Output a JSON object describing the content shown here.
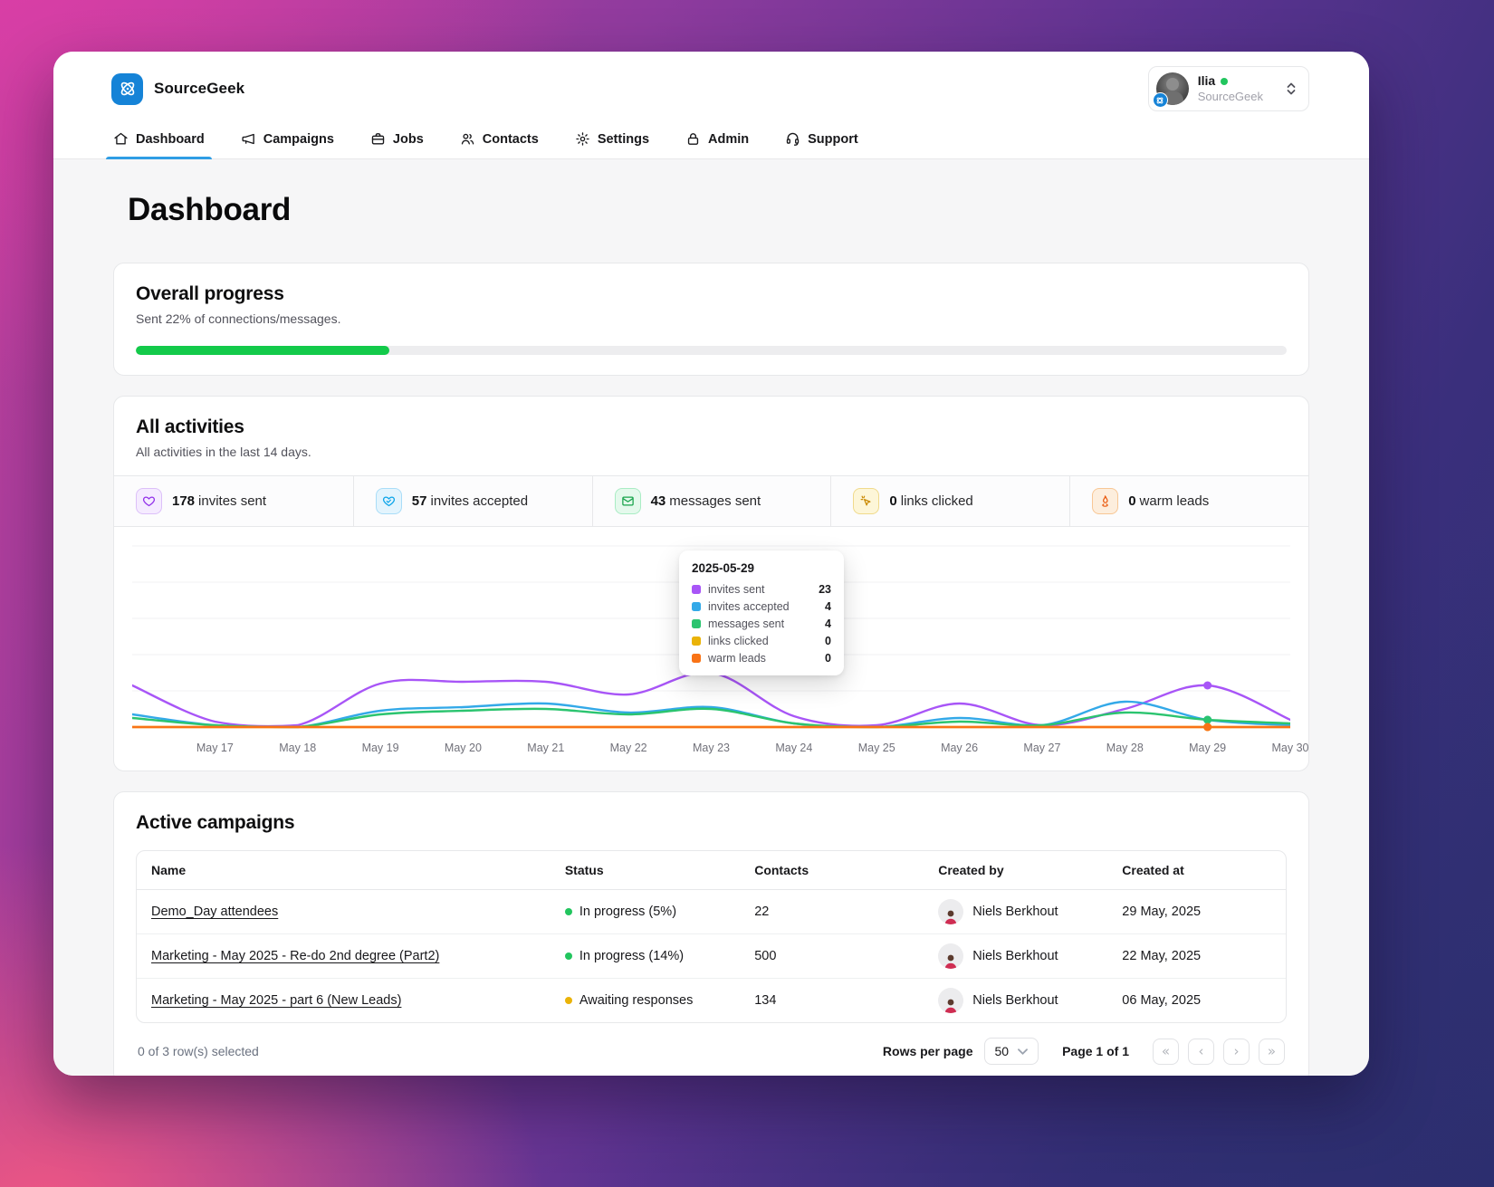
{
  "brand": {
    "name": "SourceGeek"
  },
  "user_menu": {
    "name": "Ilia",
    "org": "SourceGeek",
    "status_color": "#22c55e"
  },
  "nav": {
    "items": [
      {
        "label": "Dashboard",
        "active": true
      },
      {
        "label": "Campaigns",
        "active": false
      },
      {
        "label": "Jobs",
        "active": false
      },
      {
        "label": "Contacts",
        "active": false
      },
      {
        "label": "Settings",
        "active": false
      },
      {
        "label": "Admin",
        "active": false
      },
      {
        "label": "Support",
        "active": false
      }
    ]
  },
  "page": {
    "title": "Dashboard"
  },
  "overall_progress": {
    "title": "Overall progress",
    "subtitle": "Sent 22% of connections/messages.",
    "percent": 22,
    "bar_color": "#13ca4a",
    "track_color": "#ededef"
  },
  "activities": {
    "title": "All activities",
    "subtitle": "All activities in the last 14 days.",
    "stats": [
      {
        "value": "178",
        "label": "invites sent",
        "bg": "#f5ebff",
        "border": "#dcc0f9",
        "fg": "#9333ea"
      },
      {
        "value": "57",
        "label": "invites accepted",
        "bg": "#e3f4fd",
        "border": "#a9ddf8",
        "fg": "#0ea5e9"
      },
      {
        "value": "43",
        "label": "messages sent",
        "bg": "#e4f9ec",
        "border": "#a9ecc4",
        "fg": "#16a34a"
      },
      {
        "value": "0",
        "label": "links clicked",
        "bg": "#fdf6d8",
        "border": "#f0da8c",
        "fg": "#ca8a04"
      },
      {
        "value": "0",
        "label": "warm leads",
        "bg": "#fdeedd",
        "border": "#f8c795",
        "fg": "#ea580c"
      }
    ]
  },
  "chart_data": {
    "type": "line",
    "x_labels": [
      "May 17",
      "May 18",
      "May 19",
      "May 20",
      "May 21",
      "May 22",
      "May 23",
      "May 24",
      "May 25",
      "May 26",
      "May 27",
      "May 28",
      "May 29",
      "May 30"
    ],
    "ylim": [
      0,
      100
    ],
    "grid": "horizontal gridlines every 20, no y tick labels, legend shown only in hover tooltip",
    "hover_index": 13,
    "note": "values[0] is the unlabeled left-edge point one step before May 17; non-tooltip values estimated from pixels",
    "series": [
      {
        "name": "invites sent",
        "color": "#a855f7",
        "values": [
          23,
          3,
          1,
          24,
          25,
          25,
          18,
          30,
          6,
          1,
          13,
          1,
          10,
          23,
          4
        ]
      },
      {
        "name": "invites accepted",
        "color": "#33a9e8",
        "values": [
          7,
          1,
          0,
          9,
          11,
          13,
          8,
          11,
          2,
          0,
          5,
          1,
          14,
          4,
          1
        ]
      },
      {
        "name": "messages sent",
        "color": "#2bc46f",
        "values": [
          5,
          1,
          0,
          7,
          9,
          10,
          7,
          10,
          2,
          0,
          3,
          1,
          8,
          4,
          2
        ]
      },
      {
        "name": "links clicked",
        "color": "#eab308",
        "values": [
          0,
          0,
          0,
          0,
          0,
          0,
          0,
          0,
          0,
          0,
          0,
          0,
          0,
          0,
          0
        ]
      },
      {
        "name": "warm leads",
        "color": "#f97316",
        "values": [
          0,
          0,
          0,
          0,
          0,
          0,
          0,
          0,
          0,
          0,
          0,
          0,
          0,
          0,
          0
        ]
      }
    ]
  },
  "tooltip": {
    "date": "2025-05-29",
    "rows": [
      {
        "label": "invites sent",
        "value": "23",
        "color": "#a855f7"
      },
      {
        "label": "invites accepted",
        "value": "4",
        "color": "#33a9e8"
      },
      {
        "label": "messages sent",
        "value": "4",
        "color": "#2bc46f"
      },
      {
        "label": "links clicked",
        "value": "0",
        "color": "#eab308"
      },
      {
        "label": "warm leads",
        "value": "0",
        "color": "#f97316"
      }
    ]
  },
  "campaigns": {
    "title": "Active campaigns",
    "columns": [
      "Name",
      "Status",
      "Contacts",
      "Created by",
      "Created at"
    ],
    "rows": [
      {
        "name": "Demo_Day attendees",
        "status": "In progress (5%)",
        "status_color": "#22c55e",
        "contacts": "22",
        "created_by": "Niels Berkhout",
        "created_at": "29 May, 2025"
      },
      {
        "name": "Marketing - May 2025 - Re-do 2nd degree (Part2)",
        "status": "In progress (14%)",
        "status_color": "#22c55e",
        "contacts": "500",
        "created_by": "Niels Berkhout",
        "created_at": "22 May, 2025"
      },
      {
        "name": "Marketing - May 2025 - part 6 (New Leads)",
        "status": "Awaiting responses",
        "status_color": "#eab308",
        "contacts": "134",
        "created_by": "Niels Berkhout",
        "created_at": "06 May, 2025"
      }
    ],
    "footer": {
      "selected_text": "0 of 3 row(s) selected",
      "rows_per_page_label": "Rows per page",
      "rows_per_page_value": "50",
      "page_text": "Page 1 of 1"
    }
  }
}
